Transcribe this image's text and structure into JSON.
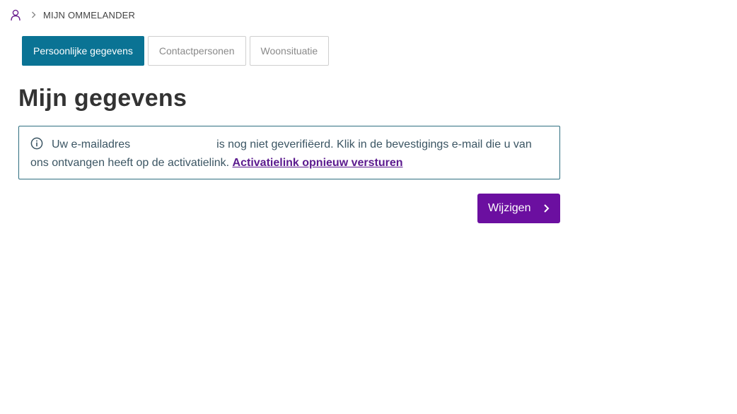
{
  "breadcrumb": {
    "home_icon": "user-icon",
    "separator_icon": "chevron-right-icon",
    "current": "MIJN OMMELANDER"
  },
  "tabs": [
    {
      "label": "Persoonlijke gegevens",
      "active": true
    },
    {
      "label": "Contactpersonen",
      "active": false
    },
    {
      "label": "Woonsituatie",
      "active": false
    }
  ],
  "page": {
    "title": "Mijn gegevens"
  },
  "alert": {
    "icon": "info-icon",
    "prefix": "Uw e-mailadres",
    "message": "is nog niet geverifiëerd. Klik in de bevestigings e-mail die u van ons ontvangen heeft op de activatielink.",
    "link_label": "Activatielink opnieuw versturen"
  },
  "actions": {
    "edit_label": "Wijzigen",
    "edit_icon": "chevron-right-icon"
  },
  "colors": {
    "tab_active_bg": "#0a7394",
    "button_bg": "#6b0fa0",
    "link": "#5b1a8e",
    "alert_border": "#2e6e80"
  }
}
